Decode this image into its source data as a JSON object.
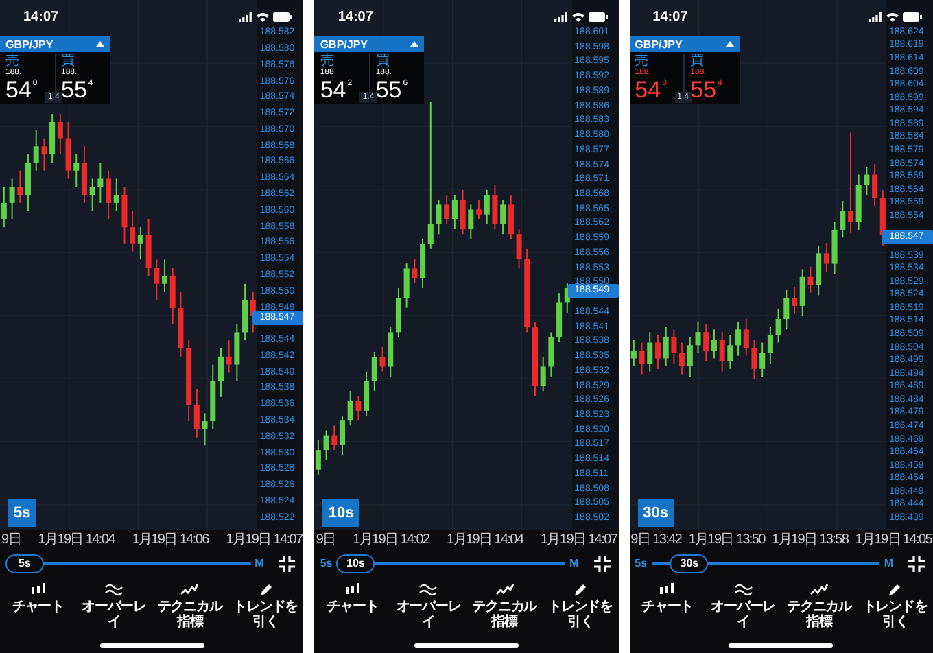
{
  "panels": [
    {
      "status_bar": {
        "time": "14:07"
      },
      "ticker": {
        "symbol": "GBP/JPY",
        "price_down": false,
        "sell": {
          "label": "売",
          "prefix": "188.",
          "big": "54",
          "pip": "0"
        },
        "spread": "1.4",
        "buy": {
          "label": "買",
          "prefix": "188.",
          "big": "55",
          "pip": "4"
        }
      },
      "chart_data": {
        "type": "candlestick",
        "categories": [
          null,
          null,
          null,
          null,
          null,
          null,
          null,
          null,
          null,
          null,
          null,
          null,
          null,
          null,
          null,
          null,
          null,
          null,
          null,
          null,
          null,
          null,
          null,
          null,
          null,
          null,
          null,
          null,
          null,
          null,
          null,
          null
        ],
        "ylim": [
          188.5206,
          188.5861
        ],
        "grid": true,
        "yticks": [
          {
            "value": 188.582,
            "label": "188.582"
          },
          {
            "value": 188.58,
            "label": "188.580"
          },
          {
            "value": 188.578,
            "label": "188.578"
          },
          {
            "value": 188.576,
            "label": "188.576"
          },
          {
            "value": 188.574,
            "label": "188.574"
          },
          {
            "value": 188.572,
            "label": "188.572"
          },
          {
            "value": 188.57,
            "label": "188.570"
          },
          {
            "value": 188.568,
            "label": "188.568"
          },
          {
            "value": 188.566,
            "label": "188.566"
          },
          {
            "value": 188.564,
            "label": "188.564"
          },
          {
            "value": 188.562,
            "label": "188.562"
          },
          {
            "value": 188.56,
            "label": "188.560"
          },
          {
            "value": 188.558,
            "label": "188.558"
          },
          {
            "value": 188.556,
            "label": "188.556"
          },
          {
            "value": 188.554,
            "label": "188.554"
          },
          {
            "value": 188.552,
            "label": "188.552"
          },
          {
            "value": 188.55,
            "label": "188.550"
          },
          {
            "value": 188.548,
            "label": "188.548"
          },
          {
            "value": 188.544,
            "label": "188.544"
          },
          {
            "value": 188.542,
            "label": "188.542"
          },
          {
            "value": 188.54,
            "label": "188.540"
          },
          {
            "value": 188.538,
            "label": "188.538"
          },
          {
            "value": 188.536,
            "label": "188.536"
          },
          {
            "value": 188.534,
            "label": "188.534"
          },
          {
            "value": 188.532,
            "label": "188.532"
          },
          {
            "value": 188.53,
            "label": "188.530"
          },
          {
            "value": 188.528,
            "label": "188.528"
          },
          {
            "value": 188.526,
            "label": "188.526"
          },
          {
            "value": 188.524,
            "label": "188.524"
          },
          {
            "value": 188.522,
            "label": "188.522"
          }
        ],
        "ohlc": [
          [
            188.559,
            188.563,
            188.558,
            188.561
          ],
          [
            188.561,
            188.564,
            188.559,
            188.563
          ],
          [
            188.563,
            188.565,
            188.561,
            188.562
          ],
          [
            188.562,
            188.567,
            188.56,
            188.566
          ],
          [
            188.566,
            188.57,
            188.565,
            188.568
          ],
          [
            188.568,
            188.569,
            188.565,
            188.567
          ],
          [
            188.567,
            188.572,
            188.566,
            188.571
          ],
          [
            188.571,
            188.572,
            188.567,
            188.569
          ],
          [
            188.569,
            188.571,
            188.564,
            188.565
          ],
          [
            188.565,
            188.567,
            188.563,
            188.566
          ],
          [
            188.566,
            188.568,
            188.561,
            188.562
          ],
          [
            188.562,
            188.564,
            188.56,
            188.563
          ],
          [
            188.563,
            188.566,
            188.561,
            188.564
          ],
          [
            188.564,
            188.565,
            188.559,
            188.561
          ],
          [
            188.561,
            188.564,
            188.56,
            188.562
          ],
          [
            188.562,
            188.563,
            188.556,
            188.558
          ],
          [
            188.558,
            188.56,
            188.555,
            188.556
          ],
          [
            188.556,
            188.558,
            188.554,
            188.557
          ],
          [
            188.557,
            188.559,
            188.552,
            188.553
          ],
          [
            188.553,
            188.554,
            188.549,
            188.551
          ],
          [
            188.551,
            188.554,
            188.55,
            188.552
          ],
          [
            188.552,
            188.553,
            188.546,
            188.548
          ],
          [
            188.548,
            188.55,
            188.542,
            188.543
          ],
          [
            188.543,
            188.544,
            188.534,
            188.536
          ],
          [
            188.536,
            188.538,
            188.532,
            188.533
          ],
          [
            188.533,
            188.535,
            188.531,
            188.534
          ],
          [
            188.534,
            188.541,
            188.533,
            188.539
          ],
          [
            188.539,
            188.543,
            188.537,
            188.542
          ],
          [
            188.542,
            188.544,
            188.54,
            188.541
          ],
          [
            188.541,
            188.546,
            188.539,
            188.545
          ],
          [
            188.545,
            188.551,
            188.544,
            188.549
          ],
          [
            188.549,
            188.55,
            188.545,
            188.547
          ]
        ]
      },
      "current_price": "188.547",
      "timeframe_badge": "5s",
      "time_axis": [
        "9日",
        "1月19日 14:04",
        "1月19日 14:06",
        "1月19日 14:07"
      ],
      "timeframe_slider": {
        "value": "5s",
        "max_label": "M",
        "level": 0
      },
      "toolbar": [
        {
          "label": "チャート"
        },
        {
          "label": "オーバーレイ"
        },
        {
          "label": "テクニカル指標"
        },
        {
          "label": "トレンドを引く"
        }
      ]
    },
    {
      "status_bar": {
        "time": "14:07"
      },
      "ticker": {
        "symbol": "GBP/JPY",
        "price_down": false,
        "sell": {
          "label": "売",
          "prefix": "188.",
          "big": "54",
          "pip": "2"
        },
        "spread": "1.4",
        "buy": {
          "label": "買",
          "prefix": "188.",
          "big": "55",
          "pip": "6"
        }
      },
      "chart_data": {
        "type": "candlestick",
        "categories": [
          null,
          null,
          null,
          null,
          null,
          null,
          null,
          null,
          null,
          null,
          null,
          null,
          null,
          null,
          null,
          null,
          null,
          null,
          null,
          null,
          null,
          null,
          null,
          null,
          null,
          null,
          null,
          null,
          null,
          null,
          null,
          null
        ],
        "ylim": [
          188.4998,
          188.6077
        ],
        "grid": true,
        "yticks": [
          {
            "value": 188.601,
            "label": "188.601"
          },
          {
            "value": 188.598,
            "label": "188.598"
          },
          {
            "value": 188.595,
            "label": "188.595"
          },
          {
            "value": 188.592,
            "label": "188.592"
          },
          {
            "value": 188.589,
            "label": "188.589"
          },
          {
            "value": 188.586,
            "label": "188.586"
          },
          {
            "value": 188.583,
            "label": "188.583"
          },
          {
            "value": 188.58,
            "label": "188.580"
          },
          {
            "value": 188.577,
            "label": "188.577"
          },
          {
            "value": 188.574,
            "label": "188.574"
          },
          {
            "value": 188.571,
            "label": "188.571"
          },
          {
            "value": 188.568,
            "label": "188.568"
          },
          {
            "value": 188.565,
            "label": "188.565"
          },
          {
            "value": 188.562,
            "label": "188.562"
          },
          {
            "value": 188.559,
            "label": "188.559"
          },
          {
            "value": 188.556,
            "label": "188.556"
          },
          {
            "value": 188.553,
            "label": "188.553"
          },
          {
            "value": 188.55,
            "label": "188.550"
          },
          {
            "value": 188.544,
            "label": "188.544"
          },
          {
            "value": 188.541,
            "label": "188.541"
          },
          {
            "value": 188.538,
            "label": "188.538"
          },
          {
            "value": 188.535,
            "label": "188.535"
          },
          {
            "value": 188.532,
            "label": "188.532"
          },
          {
            "value": 188.529,
            "label": "188.529"
          },
          {
            "value": 188.526,
            "label": "188.526"
          },
          {
            "value": 188.523,
            "label": "188.523"
          },
          {
            "value": 188.52,
            "label": "188.520"
          },
          {
            "value": 188.517,
            "label": "188.517"
          },
          {
            "value": 188.514,
            "label": "188.514"
          },
          {
            "value": 188.511,
            "label": "188.511"
          },
          {
            "value": 188.508,
            "label": "188.508"
          },
          {
            "value": 188.505,
            "label": "188.505"
          },
          {
            "value": 188.502,
            "label": "188.502"
          }
        ],
        "ohlc": [
          [
            188.512,
            188.518,
            188.511,
            188.516
          ],
          [
            188.516,
            188.52,
            188.514,
            188.519
          ],
          [
            188.519,
            188.521,
            188.516,
            188.517
          ],
          [
            188.517,
            188.523,
            188.515,
            188.522
          ],
          [
            188.522,
            188.528,
            188.521,
            188.526
          ],
          [
            188.526,
            188.527,
            188.522,
            188.524
          ],
          [
            188.524,
            188.532,
            188.523,
            188.53
          ],
          [
            188.53,
            188.536,
            188.528,
            188.535
          ],
          [
            188.535,
            188.537,
            188.532,
            188.533
          ],
          [
            188.533,
            188.541,
            188.531,
            188.54
          ],
          [
            188.54,
            188.549,
            188.539,
            188.547
          ],
          [
            188.547,
            188.554,
            188.545,
            188.553
          ],
          [
            188.553,
            188.555,
            188.55,
            188.551
          ],
          [
            188.551,
            188.559,
            188.549,
            188.558
          ],
          [
            188.558,
            188.587,
            188.557,
            188.562
          ],
          [
            188.562,
            188.567,
            188.56,
            188.566
          ],
          [
            188.566,
            188.568,
            188.562,
            188.563
          ],
          [
            188.563,
            188.568,
            188.561,
            188.567
          ],
          [
            188.567,
            188.569,
            188.56,
            188.561
          ],
          [
            188.561,
            188.566,
            188.559,
            188.565
          ],
          [
            188.565,
            188.567,
            188.563,
            188.564
          ],
          [
            188.564,
            188.569,
            188.562,
            188.568
          ],
          [
            188.568,
            188.57,
            188.561,
            188.562
          ],
          [
            188.562,
            188.567,
            188.56,
            188.566
          ],
          [
            188.566,
            188.568,
            188.559,
            188.56
          ],
          [
            188.56,
            188.561,
            188.553,
            188.555
          ],
          [
            188.555,
            188.557,
            188.54,
            188.541
          ],
          [
            188.541,
            188.542,
            188.527,
            188.529
          ],
          [
            188.529,
            188.535,
            188.528,
            188.533
          ],
          [
            188.533,
            188.54,
            188.531,
            188.539
          ],
          [
            188.539,
            188.548,
            188.538,
            188.546
          ],
          [
            188.546,
            188.55,
            188.544,
            188.549
          ]
        ]
      },
      "current_price": "188.549",
      "timeframe_badge": "10s",
      "time_axis": [
        "9日",
        "1月19日 14:02",
        "1月19日 14:04",
        "1月19日 14:07"
      ],
      "timeframe_slider": {
        "min_label": "5s",
        "value": "10s",
        "max_label": "M",
        "level": 0
      },
      "toolbar": [
        {
          "label": "チャート"
        },
        {
          "label": "オーバーレイ"
        },
        {
          "label": "テクニカル指標"
        },
        {
          "label": "トレンドを引く"
        }
      ]
    },
    {
      "status_bar": {
        "time": "14:07"
      },
      "ticker": {
        "symbol": "GBP/JPY",
        "price_down": true,
        "sell": {
          "label": "売",
          "prefix": "188.",
          "big": "54",
          "pip": "0"
        },
        "spread": "1.4",
        "buy": {
          "label": "買",
          "prefix": "188.",
          "big": "55",
          "pip": "4"
        }
      },
      "chart_data": {
        "type": "candlestick",
        "categories": [
          null,
          null,
          null,
          null,
          null,
          null,
          null,
          null,
          null,
          null,
          null,
          null,
          null,
          null,
          null,
          null,
          null,
          null,
          null,
          null,
          null,
          null,
          null,
          null,
          null,
          null,
          null,
          null,
          null,
          null,
          null,
          null
        ],
        "ylim": [
          188.4348,
          188.6365
        ],
        "grid": true,
        "yticks": [
          {
            "value": 188.624,
            "label": "188.624"
          },
          {
            "value": 188.619,
            "label": "188.619"
          },
          {
            "value": 188.614,
            "label": "188.614"
          },
          {
            "value": 188.609,
            "label": "188.609"
          },
          {
            "value": 188.604,
            "label": "188.604"
          },
          {
            "value": 188.599,
            "label": "188.599"
          },
          {
            "value": 188.594,
            "label": "188.594"
          },
          {
            "value": 188.589,
            "label": "188.589"
          },
          {
            "value": 188.584,
            "label": "188.584"
          },
          {
            "value": 188.579,
            "label": "188.579"
          },
          {
            "value": 188.574,
            "label": "188.574"
          },
          {
            "value": 188.569,
            "label": "188.569"
          },
          {
            "value": 188.564,
            "label": "188.564"
          },
          {
            "value": 188.559,
            "label": "188.559"
          },
          {
            "value": 188.554,
            "label": "188.554"
          },
          {
            "value": 188.539,
            "label": "188.539"
          },
          {
            "value": 188.534,
            "label": "188.534"
          },
          {
            "value": 188.529,
            "label": "188.529"
          },
          {
            "value": 188.524,
            "label": "188.524"
          },
          {
            "value": 188.519,
            "label": "188.519"
          },
          {
            "value": 188.514,
            "label": "188.514"
          },
          {
            "value": 188.509,
            "label": "188.509"
          },
          {
            "value": 188.504,
            "label": "188.504"
          },
          {
            "value": 188.499,
            "label": "188.499"
          },
          {
            "value": 188.494,
            "label": "188.494"
          },
          {
            "value": 188.489,
            "label": "188.489"
          },
          {
            "value": 188.484,
            "label": "188.484"
          },
          {
            "value": 188.479,
            "label": "188.479"
          },
          {
            "value": 188.474,
            "label": "188.474"
          },
          {
            "value": 188.469,
            "label": "188.469"
          },
          {
            "value": 188.464,
            "label": "188.464"
          },
          {
            "value": 188.459,
            "label": "188.459"
          },
          {
            "value": 188.454,
            "label": "188.454"
          },
          {
            "value": 188.449,
            "label": "188.449"
          },
          {
            "value": 188.444,
            "label": "188.444"
          },
          {
            "value": 188.439,
            "label": "188.439"
          }
        ],
        "ohlc": [
          [
            188.5,
            188.507,
            188.497,
            188.503
          ],
          [
            188.503,
            188.506,
            188.494,
            188.498
          ],
          [
            188.498,
            188.51,
            188.495,
            188.506
          ],
          [
            188.506,
            188.509,
            188.496,
            188.5
          ],
          [
            188.5,
            188.512,
            188.497,
            188.508
          ],
          [
            188.508,
            188.511,
            188.498,
            188.502
          ],
          [
            188.502,
            188.506,
            188.494,
            188.497
          ],
          [
            188.497,
            188.508,
            188.493,
            188.505
          ],
          [
            188.505,
            188.514,
            188.502,
            188.51
          ],
          [
            188.51,
            188.513,
            188.499,
            188.503
          ],
          [
            188.503,
            188.511,
            188.5,
            188.507
          ],
          [
            188.507,
            188.51,
            188.495,
            188.499
          ],
          [
            188.499,
            188.509,
            188.496,
            188.505
          ],
          [
            188.505,
            188.514,
            188.501,
            188.511
          ],
          [
            188.511,
            188.515,
            188.501,
            188.504
          ],
          [
            188.504,
            188.507,
            188.492,
            188.496
          ],
          [
            188.496,
            188.506,
            188.493,
            188.502
          ],
          [
            188.502,
            188.512,
            188.498,
            188.509
          ],
          [
            188.509,
            188.519,
            188.506,
            188.515
          ],
          [
            188.515,
            188.526,
            188.511,
            188.523
          ],
          [
            188.523,
            188.527,
            188.517,
            188.52
          ],
          [
            188.52,
            188.534,
            188.516,
            188.531
          ],
          [
            188.531,
            188.535,
            188.525,
            188.528
          ],
          [
            188.528,
            188.543,
            188.524,
            188.54
          ],
          [
            188.54,
            188.544,
            188.533,
            188.536
          ],
          [
            188.536,
            188.552,
            188.532,
            188.549
          ],
          [
            188.549,
            188.56,
            188.546,
            188.556
          ],
          [
            188.556,
            188.586,
            188.548,
            188.552
          ],
          [
            188.552,
            188.57,
            188.549,
            188.566
          ],
          [
            188.566,
            188.573,
            188.562,
            188.57
          ],
          [
            188.57,
            188.574,
            188.558,
            188.561
          ],
          [
            188.561,
            188.564,
            188.543,
            188.547
          ]
        ]
      },
      "current_price": "188.547",
      "timeframe_badge": "30s",
      "time_axis": [
        "9日 13:42",
        "1月19日 13:50",
        "1月19日 13:58",
        "1月19日 14:05"
      ],
      "timeframe_slider": {
        "min_label": "5s",
        "value": "30s",
        "max_label": "M",
        "level": 0.1
      },
      "toolbar": [
        {
          "label": "チャート"
        },
        {
          "label": "オーバーレイ"
        },
        {
          "label": "テクニカル指標"
        },
        {
          "label": "トレンドを引く"
        }
      ]
    }
  ]
}
